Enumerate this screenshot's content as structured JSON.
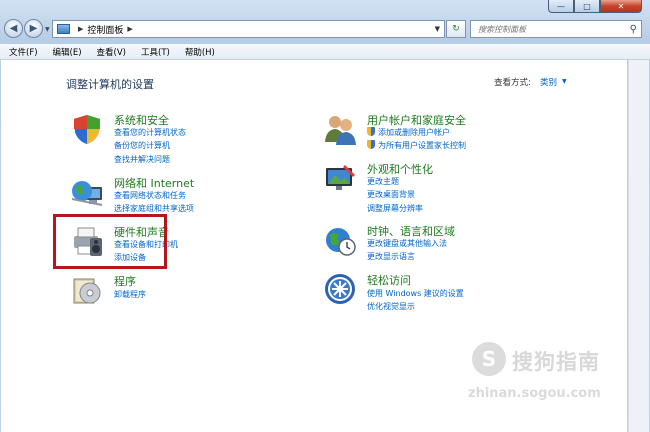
{
  "window": {
    "minimize": "—",
    "maximize": "□",
    "close": "✕"
  },
  "address": {
    "crumb": "控制面板"
  },
  "search": {
    "placeholder": "搜索控制面板"
  },
  "menu": [
    "文件(F)",
    "编辑(E)",
    "查看(V)",
    "工具(T)",
    "帮助(H)"
  ],
  "main": {
    "heading": "调整计算机的设置",
    "view_by_label": "查看方式:",
    "view_by_value": "类别",
    "categories": [
      {
        "title": "系统和安全",
        "links": [
          "查看您的计算机状态",
          "备份您的计算机",
          "查找并解决问题"
        ]
      },
      {
        "title": "网络和 Internet",
        "links": [
          "查看网络状态和任务",
          "选择家庭组和共享选项"
        ]
      },
      {
        "title": "硬件和声音",
        "links": [
          "查看设备和打印机",
          "添加设备"
        ]
      },
      {
        "title": "程序",
        "links": [
          "卸载程序"
        ]
      },
      {
        "title": "用户帐户和家庭安全",
        "links": [
          "添加或删除用户帐户",
          "为所有用户设置家长控制"
        ]
      },
      {
        "title": "外观和个性化",
        "links": [
          "更改主题",
          "更改桌面背景",
          "调整屏幕分辨率"
        ]
      },
      {
        "title": "时钟、语言和区域",
        "links": [
          "更改键盘或其他输入法",
          "更改显示语言"
        ]
      },
      {
        "title": "轻松访问",
        "links": [
          "使用 Windows 建议的设置",
          "优化视觉显示"
        ]
      }
    ]
  },
  "watermark": {
    "mark": "S",
    "text": "搜狗指南",
    "url": "zhinan.sogou.com"
  }
}
